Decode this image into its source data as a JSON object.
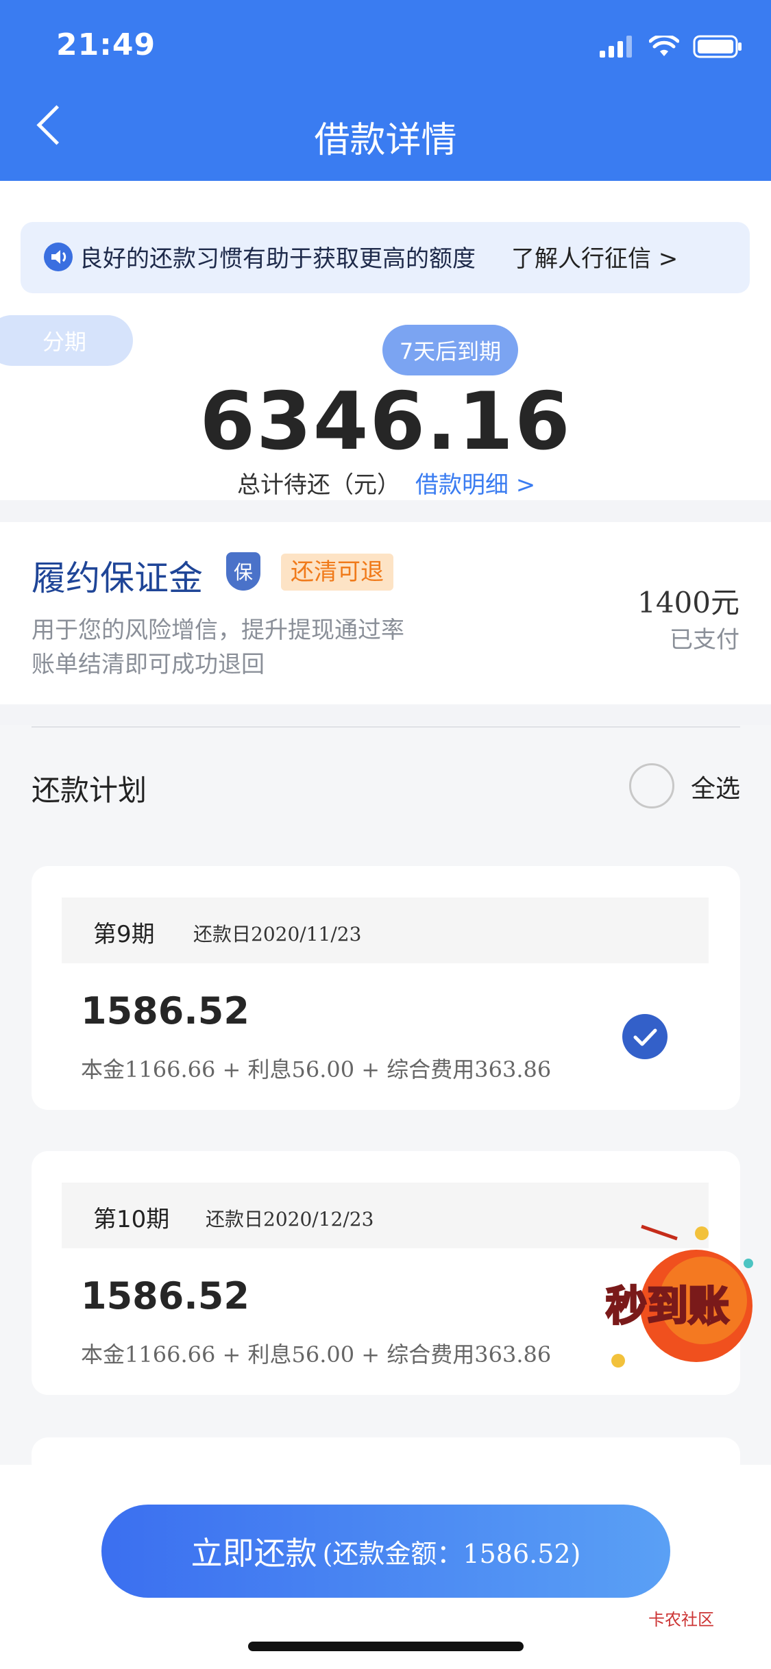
{
  "status_bar": {
    "time": "21:49"
  },
  "header": {
    "title": "借款详情"
  },
  "notice": {
    "text": "良好的还款习惯有助于获取更高的额度",
    "link": "了解人行征信 >"
  },
  "tag": "分期",
  "due_pill": "7天后到期",
  "summary": {
    "amount": "6346.16",
    "label": "总计待还（元）",
    "detail_link": "借款明细 >"
  },
  "deposit": {
    "title": "履约保证金",
    "shield_char": "保",
    "badge": "还清可退",
    "desc_line1": "用于您的风险增信，提升提现通过率",
    "desc_line2": "账单结清即可成功退回",
    "amount": "1400元",
    "status": "已支付"
  },
  "plan": {
    "title": "还款计划",
    "select_all": "全选",
    "items": [
      {
        "period": "第9期",
        "date": "还款日2020/11/23",
        "amount": "1586.52",
        "breakdown": "本金1166.66 + 利息56.00 + 综合费用363.86",
        "checked": true
      },
      {
        "period": "第10期",
        "date": "还款日2020/12/23",
        "amount": "1586.52",
        "breakdown": "本金1166.66 + 利息56.00 + 综合费用363.86",
        "checked": false
      }
    ]
  },
  "promo": {
    "text": "秒到账"
  },
  "pay_button": {
    "main": "立即还款",
    "sub": "(还款金额：1586.52)"
  },
  "watermark": {
    "text": "卡农社区"
  }
}
